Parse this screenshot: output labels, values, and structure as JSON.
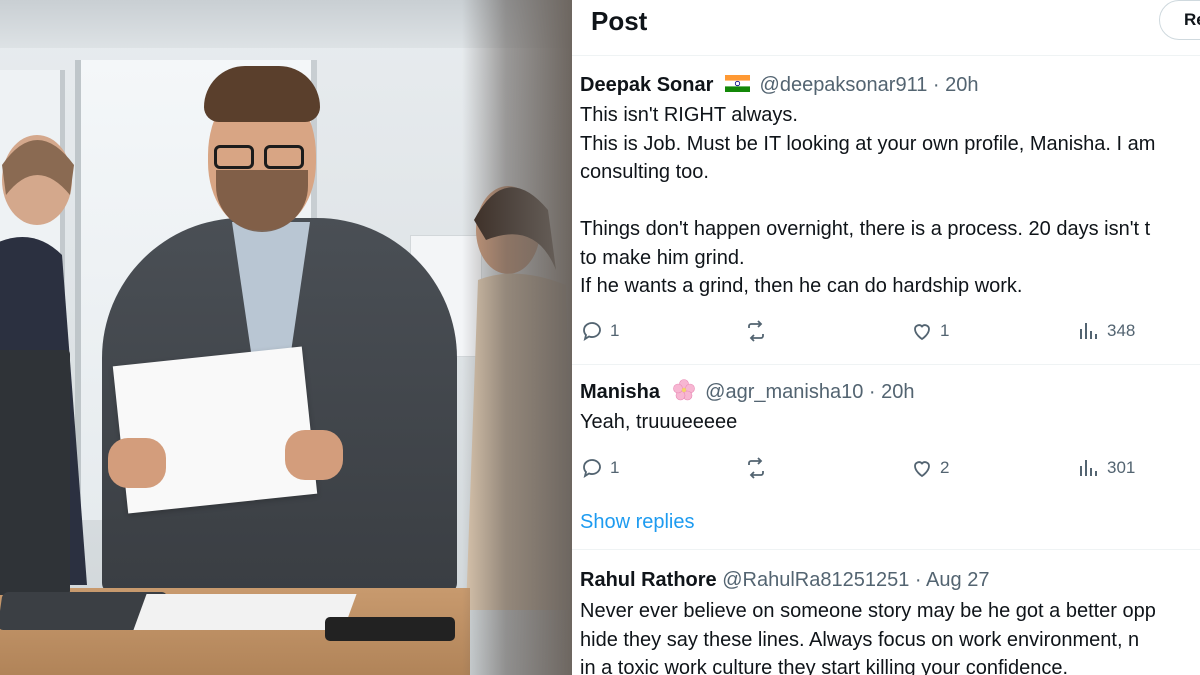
{
  "panel": {
    "title": "Post",
    "reply_button_label": "Re"
  },
  "tweets": [
    {
      "name": "Deepak Sonar",
      "badge": "india-flag-icon",
      "handle": "@deepaksonar911",
      "separator": "·",
      "time": "20h",
      "body": "This isn't RIGHT always.\nThis is Job. Must be IT looking at your own profile, Manisha. I am\nconsulting too.\n\nThings don't happen overnight, there is a process. 20 days isn't t\nto make him grind.\nIf he wants a grind, then he can do hardship work.",
      "replies": "1",
      "reposts": "",
      "likes": "1",
      "views": "348"
    },
    {
      "name": "Manisha",
      "badge": "cherry-blossom-icon",
      "handle": "@agr_manisha10",
      "separator": "·",
      "time": "20h",
      "body": "Yeah, truuueeeee",
      "replies": "1",
      "reposts": "",
      "likes": "2",
      "views": "301"
    },
    {
      "name": "Rahul Rathore",
      "handle": "@RahulRa81251251",
      "separator": "·",
      "time": "Aug 27",
      "body": "Never ever believe on someone story may be he got a better opp\nhide they say these lines.  Always focus on work environment,  n\nin a toxic work culture they start killing your confidence."
    }
  ],
  "show_replies": "Show replies",
  "colors": {
    "link": "#1d9bf0",
    "muted": "#536471",
    "text": "#0f1419"
  }
}
